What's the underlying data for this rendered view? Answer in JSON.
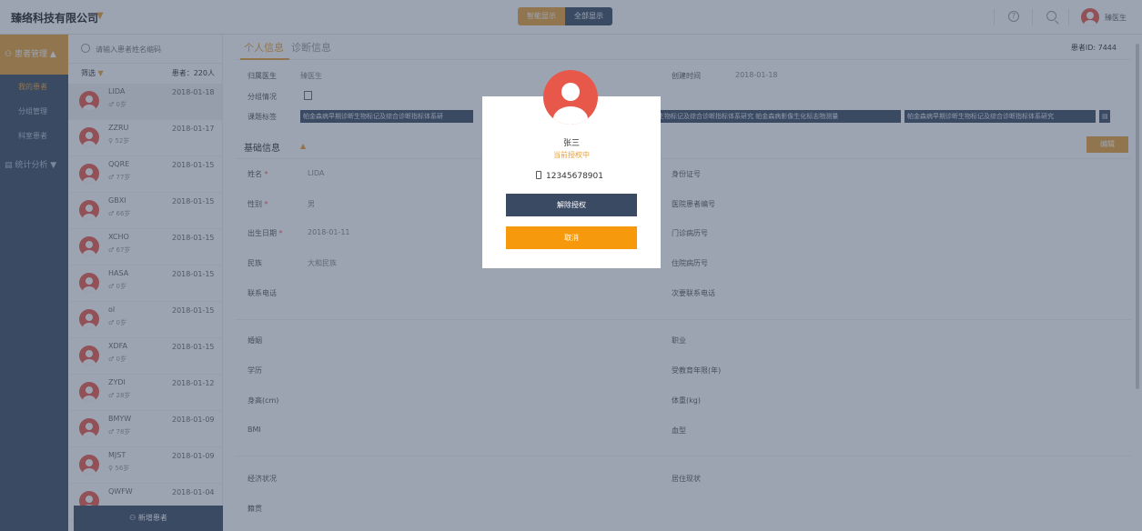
{
  "topbar": {
    "company": "臻络科技有限公司",
    "toggle_active": "智能显示",
    "toggle_other": "全部显示",
    "help": "?",
    "username": "臻医生"
  },
  "nav": {
    "header": "患者管理",
    "items": [
      "我的患者",
      "分组管理",
      "科室患者"
    ],
    "section2": "统计分析"
  },
  "patients": {
    "search_placeholder": "请输入患者姓名缩码",
    "filter_label": "筛选",
    "count_label": "患者：220人",
    "add_label": "新增患者",
    "list": [
      {
        "name": "LIDA",
        "sex": "♂",
        "age": "0岁",
        "date": "2018-01-18"
      },
      {
        "name": "ZZRU",
        "sex": "♀",
        "age": "52岁",
        "date": "2018-01-17"
      },
      {
        "name": "QQRE",
        "sex": "♂",
        "age": "77岁",
        "date": "2018-01-15"
      },
      {
        "name": "GBXI",
        "sex": "♂",
        "age": "66岁",
        "date": "2018-01-15"
      },
      {
        "name": "XCHO",
        "sex": "♂",
        "age": "67岁",
        "date": "2018-01-15"
      },
      {
        "name": "HASA",
        "sex": "♂",
        "age": "0岁",
        "date": "2018-01-15"
      },
      {
        "name": "ol",
        "sex": "♂",
        "age": "0岁",
        "date": "2018-01-15"
      },
      {
        "name": "XDFA",
        "sex": "♂",
        "age": "0岁",
        "date": "2018-01-15"
      },
      {
        "name": "ZYDI",
        "sex": "♂",
        "age": "28岁",
        "date": "2018-01-12"
      },
      {
        "name": "BMYW",
        "sex": "♂",
        "age": "78岁",
        "date": "2018-01-09"
      },
      {
        "name": "MJST",
        "sex": "♀",
        "age": "56岁",
        "date": "2018-01-09"
      },
      {
        "name": "QWFW",
        "sex": "",
        "age": "",
        "date": "2018-01-04"
      }
    ]
  },
  "main": {
    "tab1": "个人信息",
    "tab2": "诊断信息",
    "patient_id": "患者ID: 7444",
    "doctor_label": "归属医生",
    "doctor_value": "臻医生",
    "created_label": "创建时间",
    "created_value": "2018-01-18",
    "group_label": "分组情况",
    "tags_label": "课题标签",
    "tags": [
      "帕金森病早期诊断生物标记及综合诊断指标体系研",
      "生物标记及综合诊断指标体系研究",
      "帕金森病影像生化标志物测量",
      "帕金森病早期诊断生物标记及综合诊断指标体系研究"
    ],
    "basic_title": "基础信息",
    "edit_label": "编辑",
    "name_label": "姓名",
    "name_value": "LIDA",
    "idcard_label": "身份证号",
    "sex_label": "性别",
    "sex_value": "男",
    "hospital_no_label": "医院患者编号",
    "birth_label": "出生日期",
    "birth_value": "2018-01-11",
    "outpatient_label": "门诊病历号",
    "ethnic_label": "民族",
    "ethnic_value": "大和民族",
    "inpatient_label": "住院病历号",
    "phone_label": "联系电话",
    "alt_phone_label": "次要联系电话",
    "marriage_label": "婚姻",
    "job_label": "职业",
    "education_label": "学历",
    "edu_years_label": "受教育年限(年)",
    "height_label": "身高(cm)",
    "weight_label": "体重(kg)",
    "bmi_label": "BMI",
    "blood_label": "血型",
    "economy_label": "经济状况",
    "residence_label": "居住现状",
    "origin_label": "籍贯"
  },
  "modal": {
    "name": "张三",
    "status": "当前授权中",
    "phone": "12345678901",
    "revoke_label": "解除授权",
    "cancel_label": "取消"
  }
}
